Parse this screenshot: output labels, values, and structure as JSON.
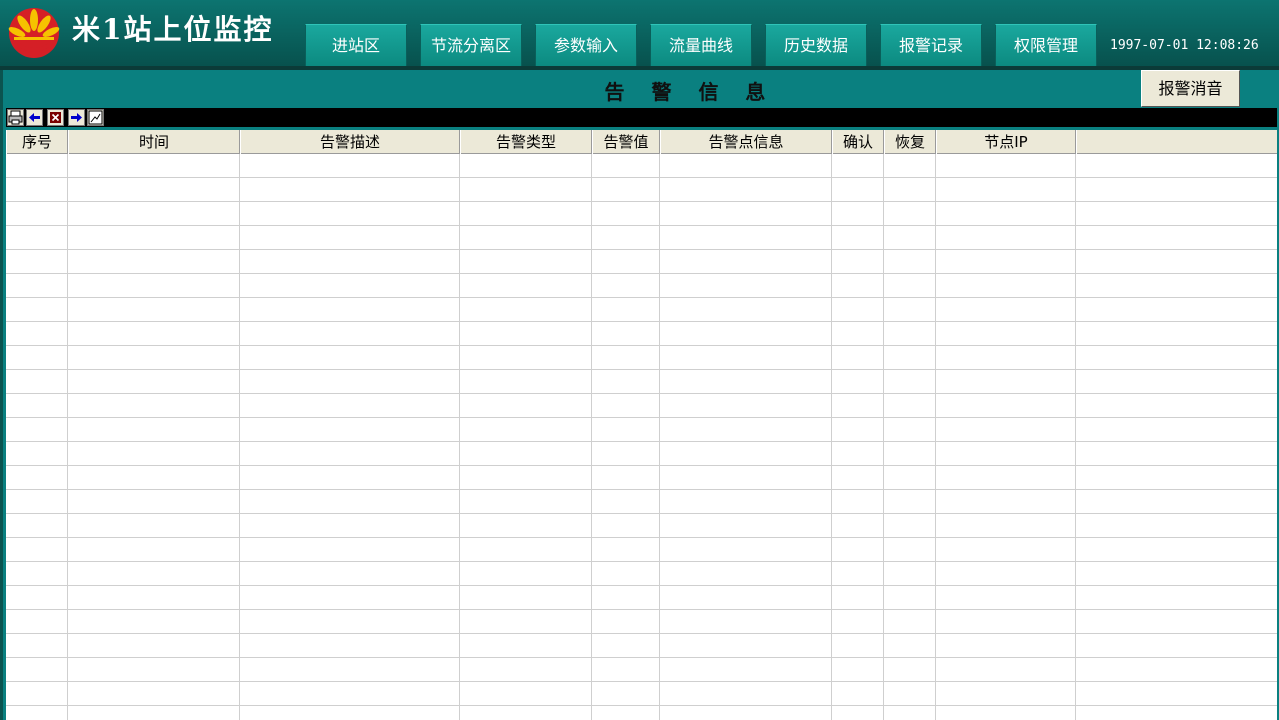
{
  "header": {
    "title": "米1站上位监控",
    "datetime": "1997-07-01 12:08:26",
    "nav": [
      "进站区",
      "节流分离区",
      "参数输入",
      "流量曲线",
      "历史数据",
      "报警记录",
      "权限管理"
    ]
  },
  "panel": {
    "title": "告 警 信 息",
    "silence_button": "报警消音"
  },
  "toolbar": {
    "icons": [
      "printer-icon",
      "arrow-left-icon",
      "close-icon",
      "arrow-right-icon",
      "export-icon"
    ]
  },
  "table": {
    "columns": [
      "序号",
      "时间",
      "告警描述",
      "告警类型",
      "告警值",
      "告警点信息",
      "确认",
      "恢复",
      "节点IP",
      ""
    ],
    "rows": []
  },
  "colors": {
    "background": "#0a8080",
    "header": "#07504c",
    "nav_button": "#1aa89e",
    "table_header": "#ece9d8",
    "toolbar": "#000000"
  }
}
